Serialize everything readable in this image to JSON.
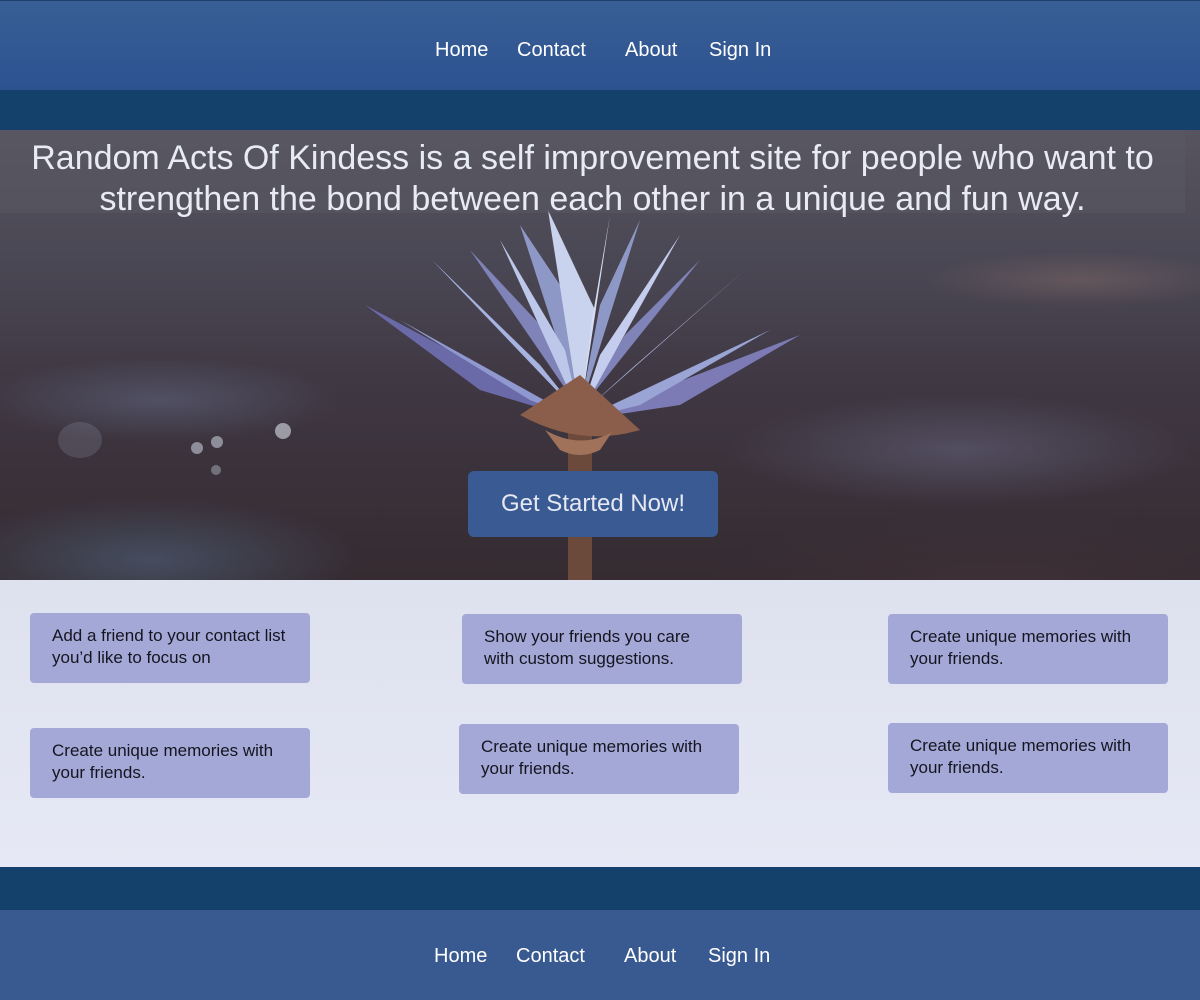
{
  "nav": {
    "home": "Home",
    "contact": "Contact",
    "about": "About",
    "sign_in": "Sign In"
  },
  "hero": {
    "headline": "Random Acts Of Kindess is a self improvement site for people who want to strengthen the bond between each other in a unique and fun way.",
    "cta_label": "Get Started Now!"
  },
  "features": [
    {
      "text": "Add a friend to your contact list you’d like to focus on"
    },
    {
      "text": "Show your friends you care with custom suggestions."
    },
    {
      "text": "Create unique memories with your friends."
    },
    {
      "text": "Create unique memories with your friends."
    },
    {
      "text": "Create unique memories with your friends."
    },
    {
      "text": "Create unique memories with your friends."
    }
  ],
  "footer_nav": {
    "home": "Home",
    "contact": "Contact",
    "about": "About",
    "sign_in": "Sign In"
  },
  "colors": {
    "nav_bg": "#395f96",
    "band": "#13416c",
    "cta_bg": "#3a5a94",
    "card_bg": "#a3a8d6",
    "page_bg": "#e4e7f3"
  }
}
